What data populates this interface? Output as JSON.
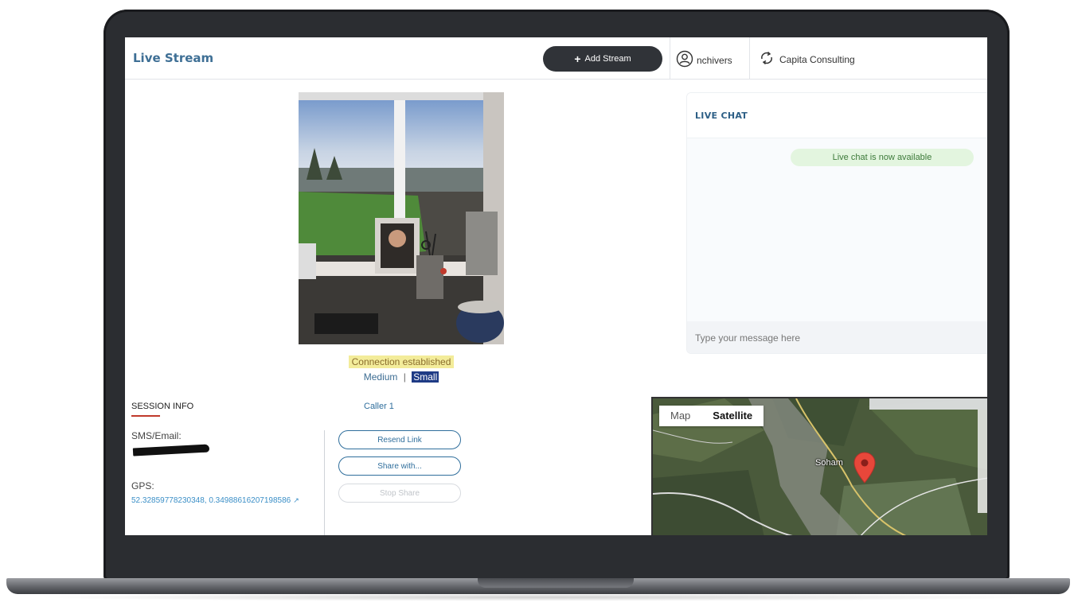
{
  "header": {
    "title": "Live Stream",
    "add_stream_label": "Add Stream",
    "username": "nchivers",
    "company": "Capita Consulting"
  },
  "video": {
    "connection_status": "Connection established",
    "size_medium": "Medium",
    "size_separator": "|",
    "size_small": "Small"
  },
  "session": {
    "title": "SESSION INFO",
    "caller": "Caller 1",
    "sms_label": "SMS/Email:",
    "gps_label": "GPS:",
    "gps_value": "52.32859778230348, 0.34988616207198586"
  },
  "actions": {
    "resend_link": "Resend Link",
    "share_with": "Share with...",
    "stop_share": "Stop Share"
  },
  "chat": {
    "title": "LIVE CHAT",
    "system_message": "Live chat is now available",
    "input_placeholder": "Type your message here"
  },
  "map": {
    "tabs": [
      "Map",
      "Satellite"
    ],
    "active_tab": "Satellite",
    "place_label": "Soham"
  },
  "colors": {
    "accent": "#3e6f95",
    "primary_button": "#303338",
    "status_highlight": "#f3ec9a",
    "selected_size": "#1f3b85",
    "chat_pill": "#e3f5df",
    "map_pin": "#e8473a"
  }
}
